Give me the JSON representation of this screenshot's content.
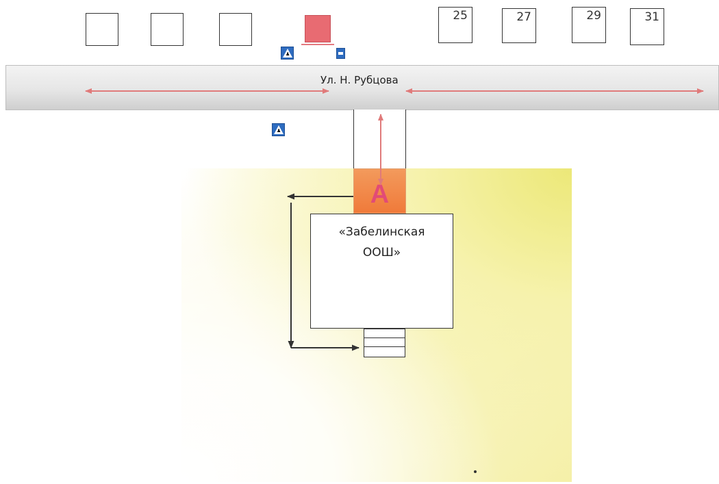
{
  "street": {
    "name": "Ул. Н. Рубцова"
  },
  "houses": [
    {
      "number": ""
    },
    {
      "number": ""
    },
    {
      "number": ""
    },
    {
      "number": "25"
    },
    {
      "number": "27"
    },
    {
      "number": "29"
    },
    {
      "number": "31"
    }
  ],
  "school": {
    "name_line1": "«Забелинская",
    "name_line2": "ООШ»"
  },
  "zone_marker": {
    "label": "А"
  },
  "signs": {
    "pedestrian_crossing": "pedestrian-crossing-icon",
    "bus_stop": "bus-stop-icon"
  },
  "colors": {
    "road_arrows": "#e07a7a",
    "walk_arrows": "#333333",
    "zone_fill": "#f07a3a",
    "zone_letter": "#e24b76",
    "territory": "#f5f0a8",
    "red_building": "#e86b72",
    "sign_blue": "#2e6cc0"
  }
}
